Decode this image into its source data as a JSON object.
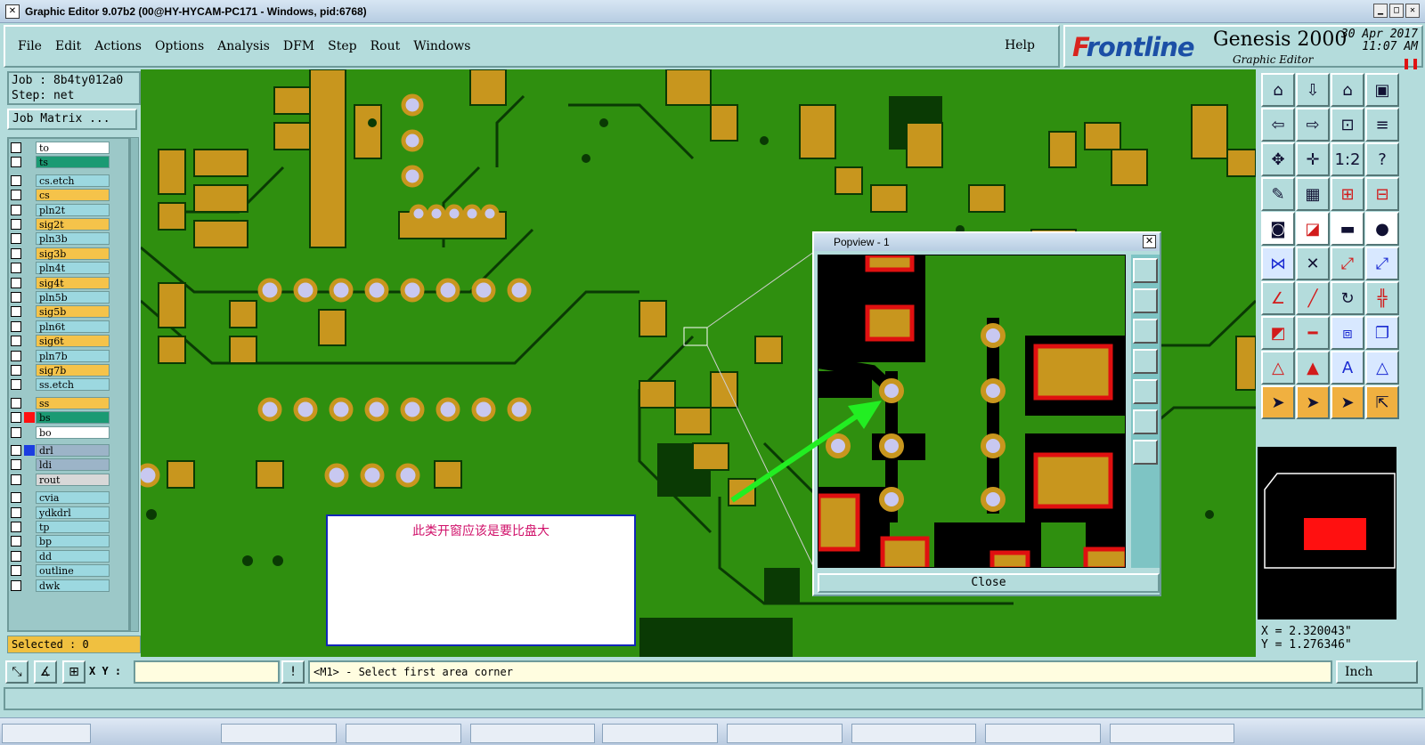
{
  "window": {
    "title": "Graphic Editor 9.07b2 (00@HY-HYCAM-PC171 - Windows, pid:6768)"
  },
  "menu": {
    "items": [
      "File",
      "Edit",
      "Actions",
      "Options",
      "Analysis",
      "DFM",
      "Step",
      "Rout",
      "Windows"
    ],
    "help": "Help"
  },
  "brand": {
    "logo_first": "F",
    "logo_rest": "rontline",
    "product": "Genesis 2000",
    "subtitle": "Graphic Editor",
    "date": "30 Apr 2017",
    "time": "11:07 AM"
  },
  "job": {
    "job_line": "Job : 8b4ty012a0",
    "step_line": "Step: net",
    "job_matrix": "Job Matrix ..."
  },
  "layers": [
    {
      "name": "to",
      "color": "#ffffff"
    },
    {
      "name": "ts",
      "color": "#1b9a73"
    },
    {
      "name": "cs.etch",
      "color": "#9cd8e0"
    },
    {
      "name": "cs",
      "color": "#f5c34a"
    },
    {
      "name": "pln2t",
      "color": "#9cd8e0"
    },
    {
      "name": "sig2t",
      "color": "#f5c34a"
    },
    {
      "name": "pln3b",
      "color": "#9cd8e0"
    },
    {
      "name": "sig3b",
      "color": "#f5c34a"
    },
    {
      "name": "pln4t",
      "color": "#9cd8e0"
    },
    {
      "name": "sig4t",
      "color": "#f5c34a"
    },
    {
      "name": "pln5b",
      "color": "#9cd8e0"
    },
    {
      "name": "sig5b",
      "color": "#f5c34a"
    },
    {
      "name": "pln6t",
      "color": "#9cd8e0"
    },
    {
      "name": "sig6t",
      "color": "#f5c34a"
    },
    {
      "name": "pln7b",
      "color": "#9cd8e0"
    },
    {
      "name": "sig7b",
      "color": "#f5c34a"
    },
    {
      "name": "ss.etch",
      "color": "#9cd8e0"
    },
    {
      "name": "ss",
      "color": "#f5c34a"
    },
    {
      "name": "bs",
      "color": "#1b9a73"
    },
    {
      "name": "bo",
      "color": "#ffffff"
    },
    {
      "name": "drl",
      "color": "#9cb4c8"
    },
    {
      "name": "ldi",
      "color": "#9cb4c8"
    },
    {
      "name": "rout",
      "color": "#d8d8d8"
    },
    {
      "name": "cvia",
      "color": "#9cd8e0"
    },
    {
      "name": "ydkdrl",
      "color": "#9cd8e0"
    },
    {
      "name": "tp",
      "color": "#9cd8e0"
    },
    {
      "name": "bp",
      "color": "#9cd8e0"
    },
    {
      "name": "dd",
      "color": "#9cd8e0"
    },
    {
      "name": "outline",
      "color": "#9cd8e0"
    },
    {
      "name": "dwk",
      "color": "#9cd8e0"
    }
  ],
  "selected": "Selected : 0",
  "popview": {
    "title": "Popview - 1",
    "close": "Close"
  },
  "note": "此类开窗应该是要比盘大",
  "coords": {
    "x": "X = 2.320043\"",
    "y": "Y = 1.276346\""
  },
  "bottom": {
    "xy_label": "X Y :",
    "xy_value": "",
    "prompt": "<M1> - Select first area corner",
    "units": "Inch",
    "warn": "!"
  },
  "colors": {
    "board": "#2f8f0f",
    "pad": "#c8961e",
    "via": "#c8c8f0",
    "panel": "#b4dcdc",
    "arrow": "#22ee22"
  }
}
